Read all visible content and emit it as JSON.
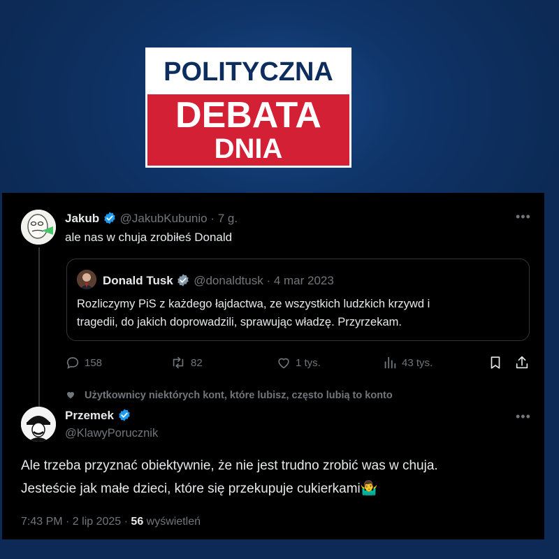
{
  "logo": {
    "line1": "POLITYCZNA",
    "line2": "DEBATA",
    "line3": "DNIA"
  },
  "reply": {
    "name": "Jakub",
    "handle": "@JakubKubunio",
    "time": "· 7 g.",
    "text": "ale nas w chuja zrobiłeś Donald"
  },
  "quote": {
    "name": "Donald Tusk",
    "handle": "@donaldtusk",
    "date": "· 4 mar 2023",
    "text_line1": "Rozliczymy PiS z każdego łajdactwa, ze wszystkich ludzkich krzywd i",
    "text_line2": "tragedii, do jakich doprowadzili, sprawując władzę. Przyrzekam."
  },
  "actions": {
    "replies": "158",
    "reposts": "82",
    "likes": "1 tys.",
    "views": "43 tys."
  },
  "social_context": "Użytkownicy niektórych kont, które lubisz, często lubią to konto",
  "main": {
    "name": "Przemek",
    "handle": "@KlawyPorucznik",
    "text_line1": "Ale trzeba przyznać obiektywnie, że nie jest trudno zrobić was w chuja.",
    "text_line2": "Jesteście jak małe dzieci, które się przekupuje cukierkami",
    "emoji": "🤷‍♂️",
    "timestamp": "7:43 PM · 2 lip 2025 ·",
    "views_count": "56",
    "views_label": "wyświetleń"
  },
  "colors": {
    "background": "#0c2a55",
    "logo_red": "#d42035",
    "verified": "#1d9bf0"
  }
}
